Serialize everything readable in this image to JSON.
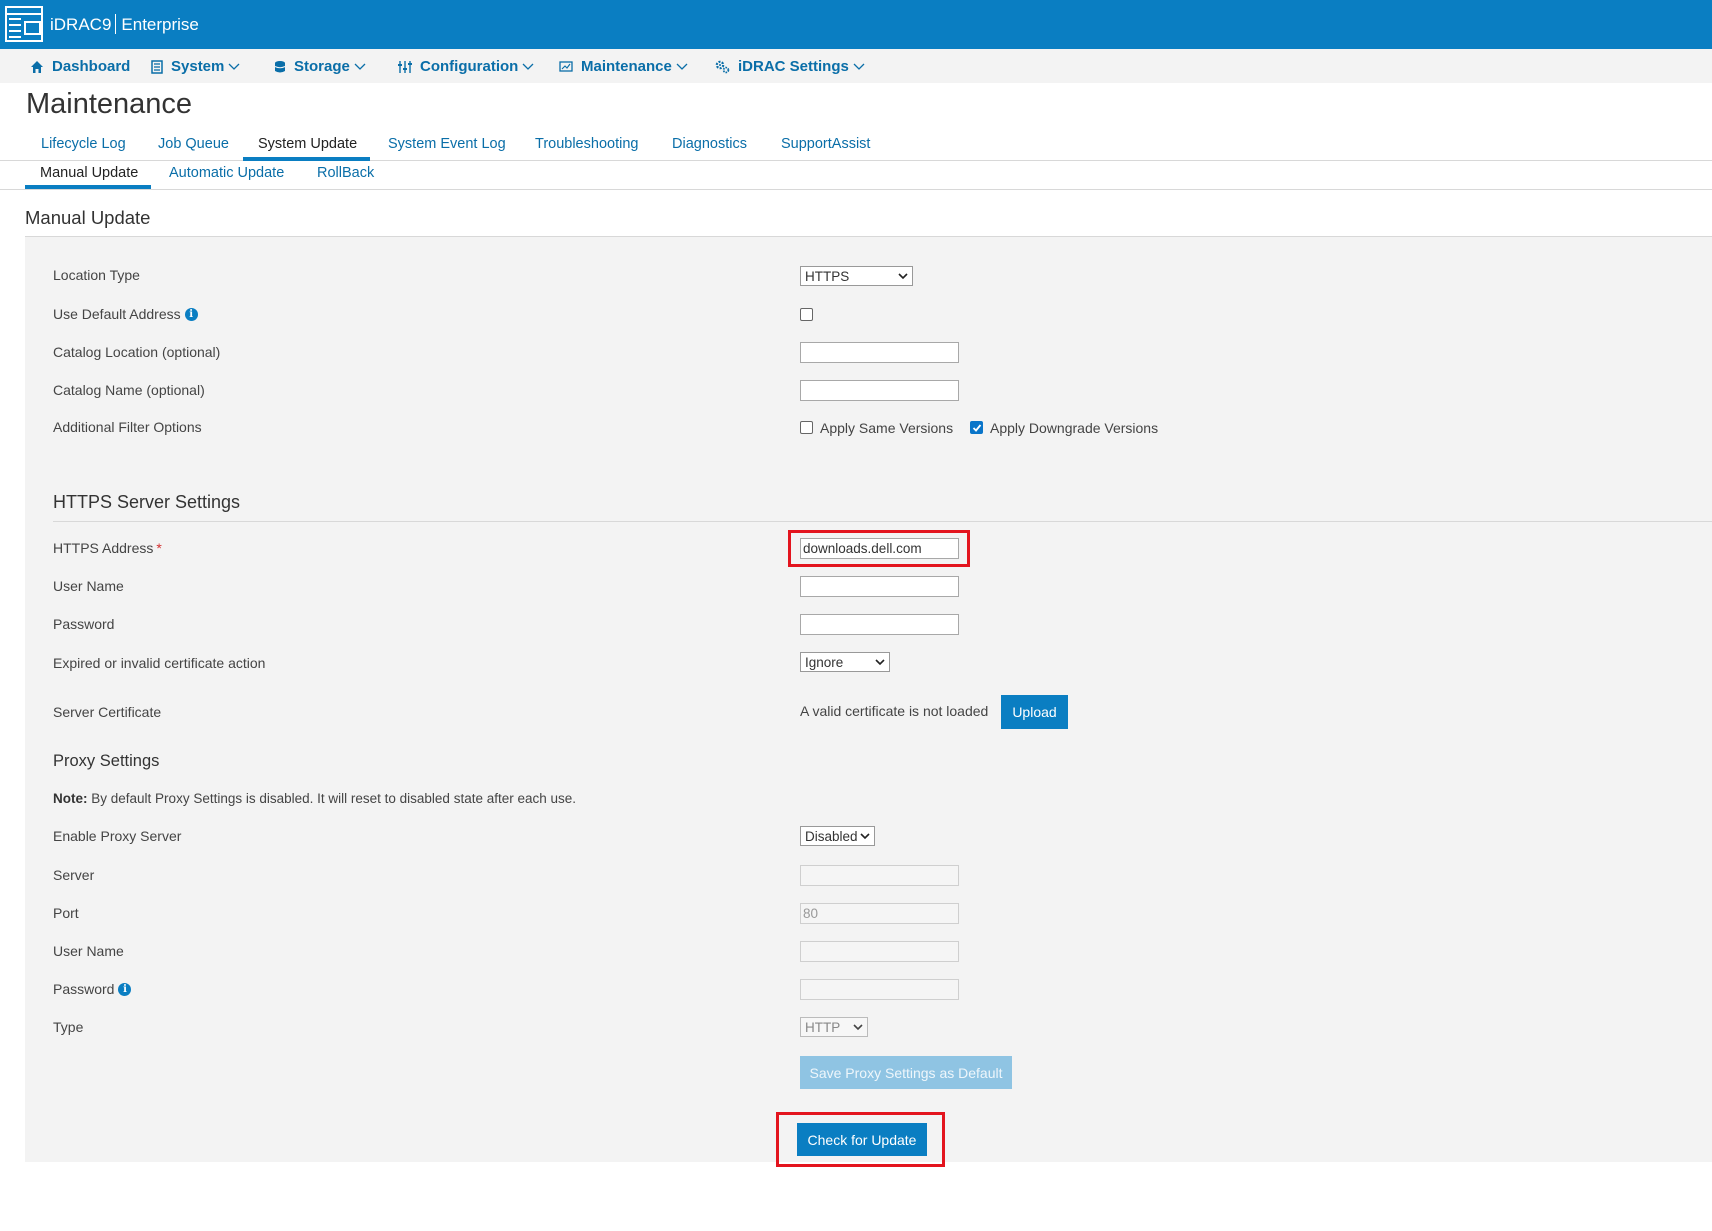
{
  "header": {
    "product": "iDRAC9",
    "edition": "Enterprise",
    "color": "#0a7ec2"
  },
  "nav": {
    "items": [
      {
        "label": "Dashboard",
        "icon": "home-icon"
      },
      {
        "label": "System",
        "icon": "server-icon"
      },
      {
        "label": "Storage",
        "icon": "database-icon"
      },
      {
        "label": "Configuration",
        "icon": "sliders-icon"
      },
      {
        "label": "Maintenance",
        "icon": "monitor-icon"
      },
      {
        "label": "iDRAC Settings",
        "icon": "gears-icon"
      }
    ]
  },
  "page": {
    "title": "Maintenance"
  },
  "tabs": {
    "items": [
      "Lifecycle Log",
      "Job Queue",
      "System Update",
      "System Event Log",
      "Troubleshooting",
      "Diagnostics",
      "SupportAssist"
    ],
    "active": "System Update"
  },
  "subtabs": {
    "items": [
      "Manual Update",
      "Automatic Update",
      "RollBack"
    ],
    "active": "Manual Update"
  },
  "manual_update": {
    "title": "Manual Update",
    "location_type": {
      "label": "Location Type",
      "value": "HTTPS"
    },
    "use_default_address": {
      "label": "Use Default Address",
      "checked": false
    },
    "catalog_location": {
      "label": "Catalog Location (optional)",
      "value": ""
    },
    "catalog_name": {
      "label": "Catalog Name (optional)",
      "value": ""
    },
    "filter_options": {
      "label": "Additional Filter Options",
      "apply_same": {
        "label": "Apply Same Versions",
        "checked": false
      },
      "apply_downgrade": {
        "label": "Apply Downgrade Versions",
        "checked": true
      }
    }
  },
  "https_settings": {
    "title": "HTTPS Server Settings",
    "address": {
      "label": "HTTPS Address",
      "required_mark": "*",
      "value": "downloads.dell.com"
    },
    "user_name": {
      "label": "User Name",
      "value": ""
    },
    "password": {
      "label": "Password",
      "value": ""
    },
    "cert_action": {
      "label": "Expired or invalid certificate action",
      "value": "Ignore"
    },
    "server_cert": {
      "label": "Server Certificate",
      "status": "A valid certificate is not loaded",
      "upload_label": "Upload"
    }
  },
  "proxy_settings": {
    "title": "Proxy Settings",
    "note_prefix": "Note:",
    "note_text": "By default Proxy Settings is disabled. It will reset to disabled state after each use.",
    "enable": {
      "label": "Enable Proxy Server",
      "value": "Disabled"
    },
    "server": {
      "label": "Server",
      "value": ""
    },
    "port": {
      "label": "Port",
      "value": "80"
    },
    "user_name": {
      "label": "User Name",
      "value": ""
    },
    "password": {
      "label": "Password",
      "value": ""
    },
    "type": {
      "label": "Type",
      "value": "HTTP"
    },
    "save_label": "Save Proxy Settings as Default"
  },
  "actions": {
    "check_label": "Check for Update",
    "highlight_color": "#e3141e"
  }
}
